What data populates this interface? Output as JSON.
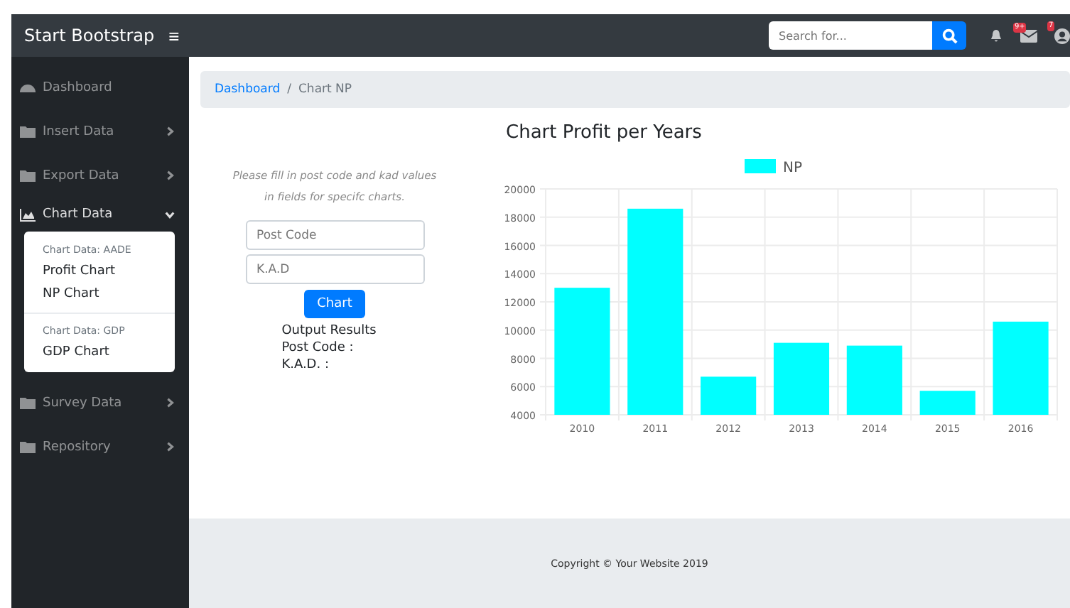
{
  "navbar": {
    "brand": "Start Bootstrap",
    "toggle": "≡",
    "search": {
      "placeholder": "Search for..."
    },
    "messages_badge": "9+",
    "user_badge": "7"
  },
  "sidebar": {
    "items": [
      {
        "label": "Dashboard",
        "kind": "gauge",
        "expanded": false,
        "has_caret": false
      },
      {
        "label": "Insert Data",
        "kind": "folder",
        "expanded": false,
        "has_caret": true
      },
      {
        "label": "Export Data",
        "kind": "folder",
        "expanded": false,
        "has_caret": true
      },
      {
        "label": "Chart Data",
        "kind": "chart",
        "expanded": true,
        "has_caret": true,
        "submenu": [
          {
            "kind": "header",
            "label": "Chart Data: AADE"
          },
          {
            "kind": "link",
            "label": "Profit Chart"
          },
          {
            "kind": "link",
            "label": "NP Chart"
          },
          {
            "kind": "divider"
          },
          {
            "kind": "header",
            "label": "Chart Data: GDP"
          },
          {
            "kind": "link",
            "label": "GDP Chart"
          }
        ]
      },
      {
        "label": "Survey Data",
        "kind": "folder",
        "expanded": false,
        "has_caret": true
      },
      {
        "label": "Repository",
        "kind": "folder",
        "expanded": false,
        "has_caret": true
      }
    ]
  },
  "breadcrumb": [
    {
      "label": "Dashboard",
      "link": true
    },
    {
      "label": "Chart NP",
      "link": false
    }
  ],
  "breadcrumb_separator": "/",
  "form": {
    "hint": "Please fill in post code and kad values in fields for specifc charts.",
    "fields": [
      {
        "placeholder": "Post Code"
      },
      {
        "placeholder": "K.A.D"
      }
    ],
    "button": "Chart",
    "results": [
      "Output Results",
      "Post Code :",
      "K.A.D. :"
    ]
  },
  "chart": {
    "heading": "Chart Profit per Years",
    "chart_data": {
      "type": "bar",
      "categories": [
        "2010",
        "2011",
        "2012",
        "2013",
        "2014",
        "2015",
        "2016"
      ],
      "series": [
        {
          "name": "NP",
          "color": "#00ffff",
          "values": [
            13000,
            18600,
            6700,
            9100,
            8900,
            5700,
            10600
          ]
        }
      ],
      "ylim": [
        4000,
        20000
      ],
      "grid": true,
      "yticks": [
        4000,
        6000,
        8000,
        10000,
        12000,
        14000,
        16000,
        18000,
        20000
      ]
    }
  },
  "footer": "Copyright © Your Website 2019"
}
